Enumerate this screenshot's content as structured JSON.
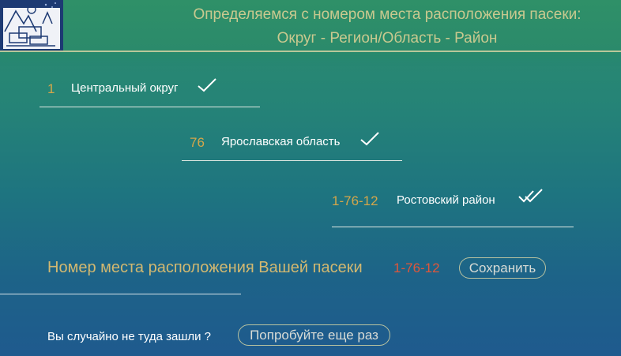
{
  "header": {
    "title_line1": "Определяемся с номером места расположения пасеки:",
    "title_line2": "Округ - Регион/Область - Район"
  },
  "selections": [
    {
      "code": "1",
      "name": "Центральный округ",
      "check_icon": "check-icon"
    },
    {
      "code": "76",
      "name": "Ярославская область",
      "check_icon": "check-icon"
    },
    {
      "code": "1-76-12",
      "name": "Ростовский район",
      "check_icon": "double-check-icon"
    }
  ],
  "result": {
    "label": "Номер места расположения Вашей пасеки",
    "value": "1-76-12",
    "save_label": "Сохранить"
  },
  "retry": {
    "question": "Вы случайно не туда зашли ?",
    "button_label": "Попробуйте еще раз"
  },
  "colors": {
    "code": "#d4a64a",
    "result_value": "#e0563a",
    "header_text": "#c9c98f"
  }
}
